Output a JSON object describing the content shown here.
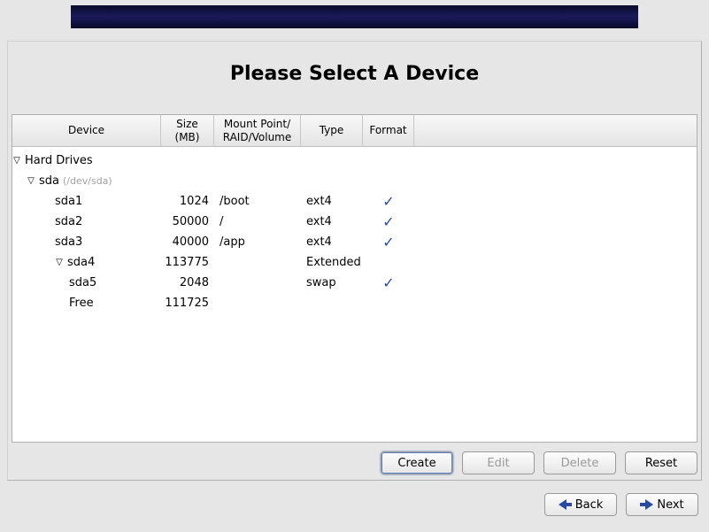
{
  "title": "Please Select A Device",
  "columns": {
    "device": "Device",
    "size": "Size (MB)",
    "mount": "Mount Point/ RAID/Volume",
    "type": "Type",
    "format": "Format"
  },
  "tree": {
    "root_label": "Hard Drives",
    "disk": {
      "name": "sda",
      "path": "(/dev/sda)",
      "partitions": [
        {
          "name": "sda1",
          "size": "1024",
          "mount": "/boot",
          "type": "ext4",
          "format": true,
          "indent": 3
        },
        {
          "name": "sda2",
          "size": "50000",
          "mount": "/",
          "type": "ext4",
          "format": true,
          "indent": 3
        },
        {
          "name": "sda3",
          "size": "40000",
          "mount": "/app",
          "type": "ext4",
          "format": true,
          "indent": 3
        },
        {
          "name": "sda4",
          "size": "113775",
          "mount": "",
          "type": "Extended",
          "format": false,
          "indent": 3,
          "expander": true
        },
        {
          "name": "sda5",
          "size": "2048",
          "mount": "",
          "type": "swap",
          "format": true,
          "indent": 4
        },
        {
          "name": "Free",
          "size": "111725",
          "mount": "",
          "type": "",
          "format": false,
          "indent": 4
        }
      ]
    }
  },
  "buttons": {
    "create": "Create",
    "edit": "Edit",
    "delete": "Delete",
    "reset": "Reset",
    "back": "Back",
    "next": "Next"
  }
}
